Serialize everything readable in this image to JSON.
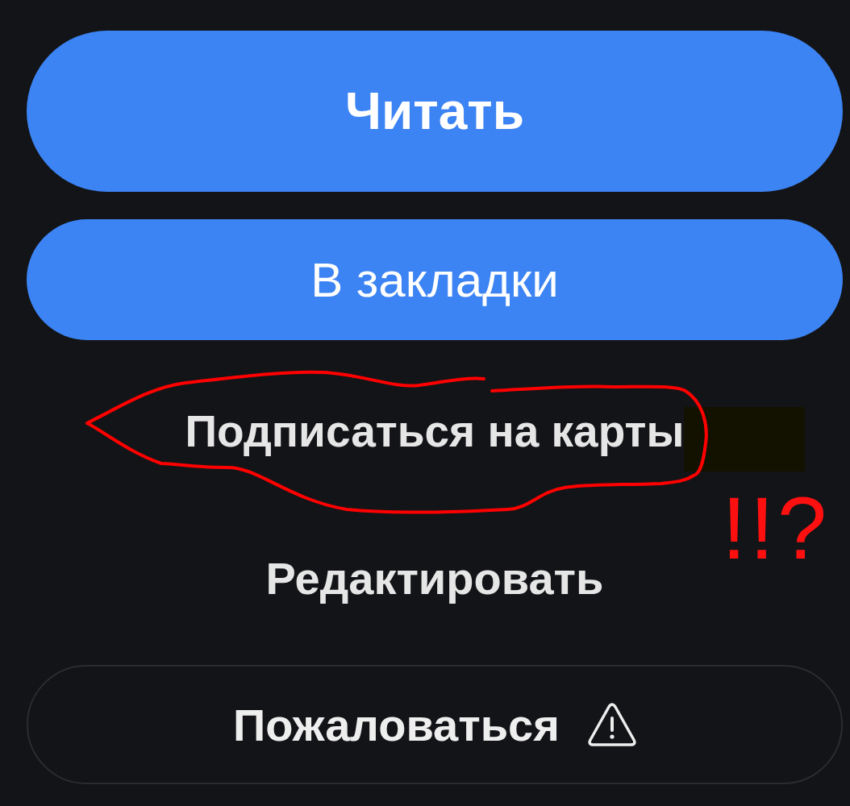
{
  "actions": [
    {
      "kind": "primary",
      "label": "Читать",
      "circled": false,
      "masked": false
    },
    {
      "kind": "secondary",
      "label": "В закладки",
      "circled": false,
      "masked": false
    },
    {
      "kind": "link",
      "label": "Подписаться на карты",
      "circled": true,
      "masked": true
    },
    {
      "kind": "link",
      "label": "Редактировать",
      "circled": false,
      "masked": false
    },
    {
      "kind": "report",
      "label": "Пожаловаться",
      "circled": false,
      "masked": false
    }
  ],
  "annotation": {
    "note": "!!?"
  }
}
